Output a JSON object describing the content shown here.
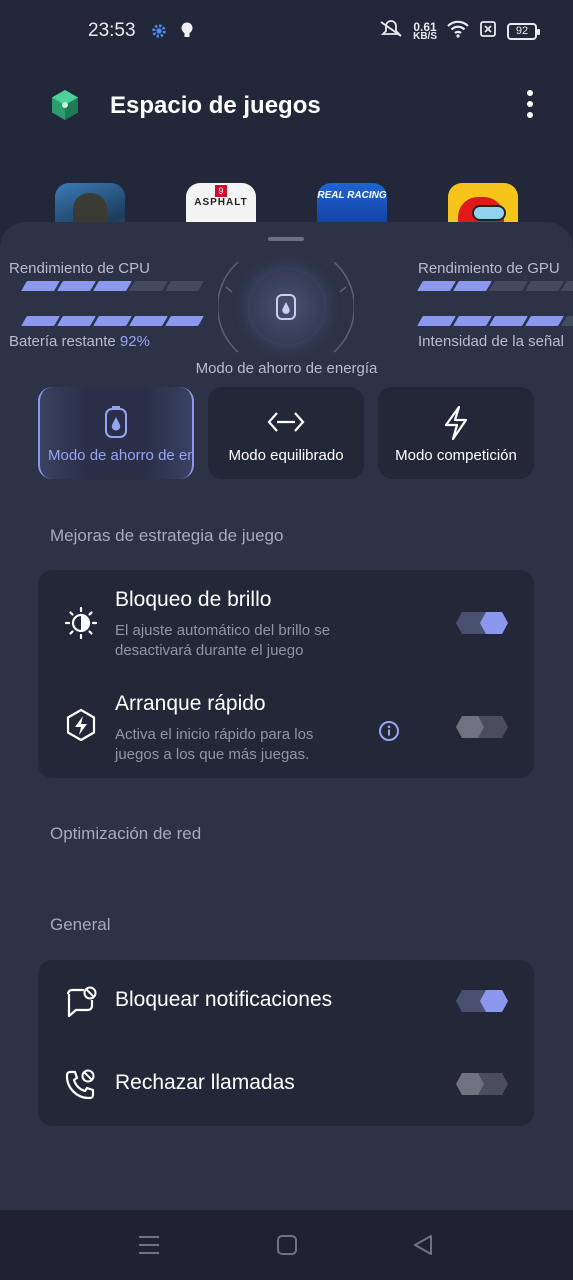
{
  "status_bar": {
    "time": "23:53",
    "net_speed_value": "0.61",
    "net_speed_unit": "KB/S",
    "battery": "92",
    "icons": [
      "settings-gear-icon",
      "bulb-icon",
      "mute-icon",
      "wifi-icon",
      "sim-off-icon",
      "battery-icon"
    ]
  },
  "header": {
    "title": "Espacio de juegos",
    "menu_icon": "more-vert-icon"
  },
  "games": [
    {
      "name": "call-of-duty"
    },
    {
      "name": "asphalt",
      "label": "ASPHALT",
      "num": "9"
    },
    {
      "name": "real-racing",
      "label": "REAL RACING"
    },
    {
      "name": "among-us"
    }
  ],
  "performance": {
    "cpu_label": "Rendimiento de CPU",
    "gpu_label": "Rendimiento de GPU",
    "battery_label": "Batería restante",
    "battery_value": "92%",
    "signal_label": "Intensidad de la señal",
    "cpu_level": 3,
    "battery_level": 5,
    "gpu_level": 2,
    "signal_level": 4,
    "mode_caption": "Modo de ahorro de energía"
  },
  "modes": [
    {
      "label": "Modo de ahorro de energía",
      "icon": "power-save-icon",
      "active": true
    },
    {
      "label": "Modo equilibrado",
      "icon": "balanced-icon",
      "active": false
    },
    {
      "label": "Modo competición",
      "icon": "competition-icon",
      "active": false
    }
  ],
  "sections": {
    "strategy": "Mejoras de estrategia de juego",
    "network": "Optimización de red",
    "general": "General"
  },
  "strategy_items": [
    {
      "title": "Bloqueo de brillo",
      "desc": "El ajuste automático del brillo se desactivará durante el juego",
      "enabled": true
    },
    {
      "title": "Arranque rápido",
      "desc": "Activa el inicio rápido para los juegos a los que más juegas.",
      "enabled": false
    }
  ],
  "general_items": [
    {
      "title": "Bloquear notificaciones",
      "enabled": true
    },
    {
      "title": "Rechazar llamadas",
      "enabled": false
    }
  ],
  "colors": {
    "accent": "#8c98ee",
    "background": "#222839",
    "sheet": "#2d3347",
    "card": "#232838"
  }
}
